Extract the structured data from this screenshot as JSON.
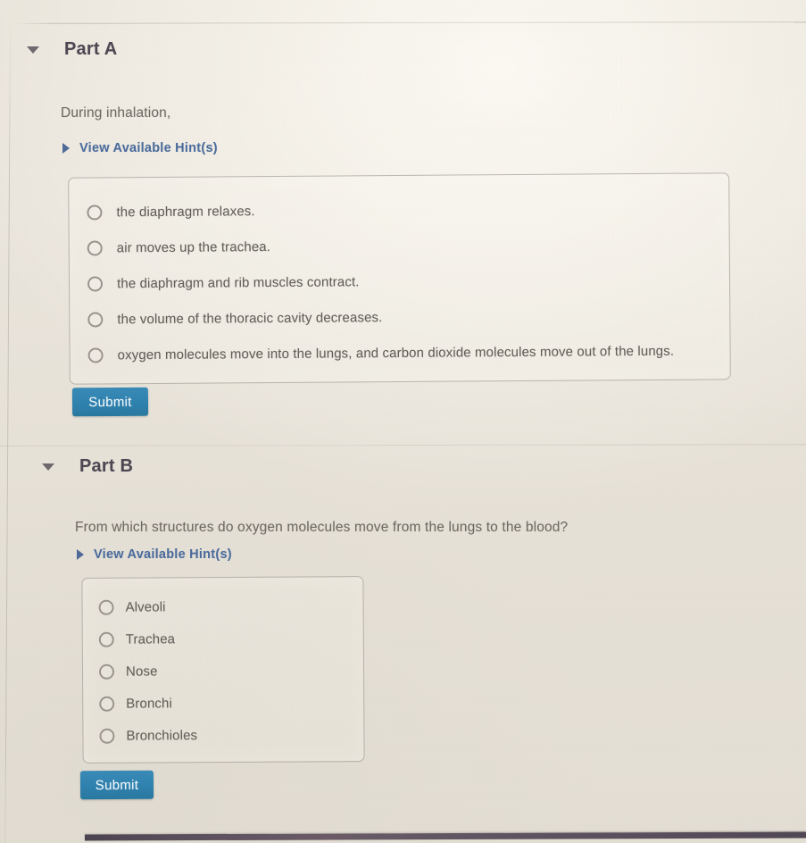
{
  "background": {
    "page_color": "#e7e2d8",
    "accent_blue": "#2f81ae",
    "link_blue": "#4a6b9c",
    "text_gray": "#6e6a63",
    "border_gray": "#969288",
    "bottom_bar_color": "#5b4f5c"
  },
  "parts": [
    {
      "id": "part-a",
      "title": "Part A",
      "collapse_icon": "caret-down-icon",
      "prompt": "During inhalation,",
      "hint": {
        "icon": "caret-right-icon",
        "label": "View Available Hint(s)"
      },
      "options": [
        {
          "value": "a1",
          "label": "the diaphragm relaxes.",
          "selected": false
        },
        {
          "value": "a2",
          "label": "air moves up the trachea.",
          "selected": false
        },
        {
          "value": "a3",
          "label": "the diaphragm and rib muscles contract.",
          "selected": false
        },
        {
          "value": "a4",
          "label": "the volume of the thoracic cavity decreases.",
          "selected": false
        },
        {
          "value": "a5",
          "label": "oxygen molecules move into the lungs, and carbon dioxide molecules move out of the lungs.",
          "selected": false
        }
      ],
      "submit_label": "Submit"
    },
    {
      "id": "part-b",
      "title": "Part B",
      "collapse_icon": "caret-down-icon",
      "prompt": "From which structures do oxygen molecules move from the lungs to the blood?",
      "hint": {
        "icon": "caret-right-icon",
        "label": "View Available Hint(s)"
      },
      "options": [
        {
          "value": "b1",
          "label": "Alveoli",
          "selected": false
        },
        {
          "value": "b2",
          "label": "Trachea",
          "selected": false
        },
        {
          "value": "b3",
          "label": "Nose",
          "selected": false
        },
        {
          "value": "b4",
          "label": "Bronchi",
          "selected": false
        },
        {
          "value": "b5",
          "label": "Bronchioles",
          "selected": false
        }
      ],
      "submit_label": "Submit"
    }
  ]
}
